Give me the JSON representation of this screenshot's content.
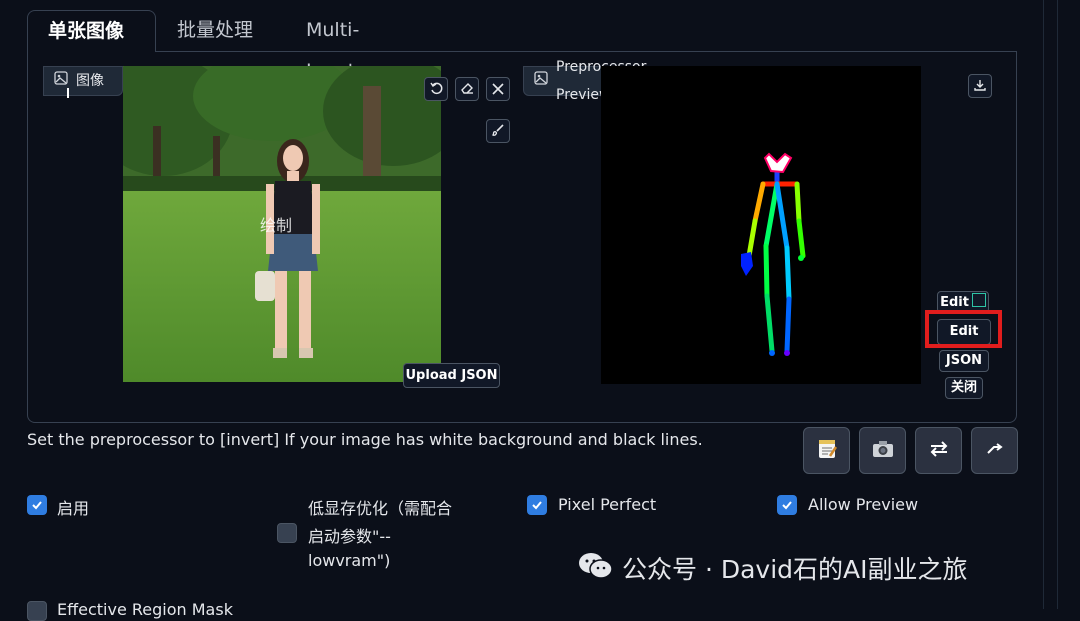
{
  "tabs": [
    {
      "label": "单张图像"
    },
    {
      "label": "批量处理"
    },
    {
      "label": "Multi-Inputs"
    }
  ],
  "input_image": {
    "label": "图像",
    "upload_json_label": "Upload JSON",
    "watermark_text": "绘制"
  },
  "preview": {
    "label": "Preprocessor Preview",
    "buttons": {
      "edit_top": "Edit",
      "edit": "Edit",
      "json": "JSON",
      "close": "关闭"
    }
  },
  "hint_text": "Set the preprocessor to [invert] If your image has white background and black lines.",
  "options": {
    "enable": {
      "label": "启用",
      "checked": true
    },
    "lowvram": {
      "label_line1": "低显存优化（需配合",
      "label_line2": "启动参数\"--",
      "label_line3": "lowvram\")",
      "checked": false
    },
    "pixel_perfect": {
      "label": "Pixel Perfect",
      "checked": true
    },
    "allow_preview": {
      "label": "Allow Preview",
      "checked": true
    },
    "effective_region": {
      "label": "Effective Region Mask",
      "checked": false
    }
  },
  "watermark": {
    "text": "公众号 · David石的AI副业之旅"
  },
  "colors": {
    "accent": "#2f7de1",
    "highlight": "#e11d1d",
    "background": "#0b0f19"
  }
}
